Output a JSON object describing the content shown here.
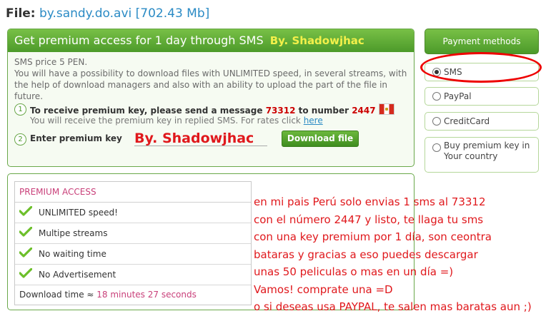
{
  "file": {
    "label": "File:",
    "name": "by.sandy.do.avi",
    "size": "[702.43 Mb]"
  },
  "sms_panel": {
    "title": "Get premium access for 1 day through SMS",
    "title_signature": "By. Shadowjhac",
    "price": "SMS price 5 PEN.",
    "description": "You will have a possibility to download files with UNLIMITED speed, in several streams, with the help of download managers and also with an ability to upload the part of the file in future.",
    "step1": {
      "number": "1",
      "text_before": "To receive premium key, please send a message ",
      "message": "73312",
      "text_middle": " to number ",
      "phone": "2447",
      "note": "You will receive the premium key in replied SMS. For rates click ",
      "link": "here"
    },
    "step2": {
      "number": "2",
      "label": "Enter premium key",
      "input_value": "By. Shadowjhac",
      "button": "Download file"
    }
  },
  "premium_access": {
    "title": "PREMIUM ACCESS",
    "features": [
      "UNLIMITED speed!",
      "Multipe streams",
      "No waiting time",
      "No Advertisement"
    ],
    "download_time_label": "Download time ≈ ",
    "download_time_value": "18 minutes 27 seconds"
  },
  "payment_methods": {
    "header": "Payment methods",
    "options": [
      {
        "label": "SMS",
        "selected": true
      },
      {
        "label": "PayPal",
        "selected": false
      },
      {
        "label": "CreditCard",
        "selected": false
      },
      {
        "label": "Buy premium key in Your country",
        "selected": false
      }
    ]
  },
  "annotation": {
    "lines": [
      "en mi pais Perú solo envias 1 sms al 73312",
      "con el número 2447 y listo, te llaga tu sms",
      "con una key premium por 1 día, son ceontra",
      "bataras y gracias a eso puedes descargar",
      "unas 50 peliculas o mas en un día =)",
      "Vamos! comprate una =D",
      "o si deseas usa PAYPAL, te salen mas baratas aun ;)"
    ]
  },
  "colors": {
    "accent_green": "#4c9a2a",
    "link_blue": "#2b8bc5",
    "annotation_red": "#e0181c",
    "premium_pink": "#c9407a"
  }
}
